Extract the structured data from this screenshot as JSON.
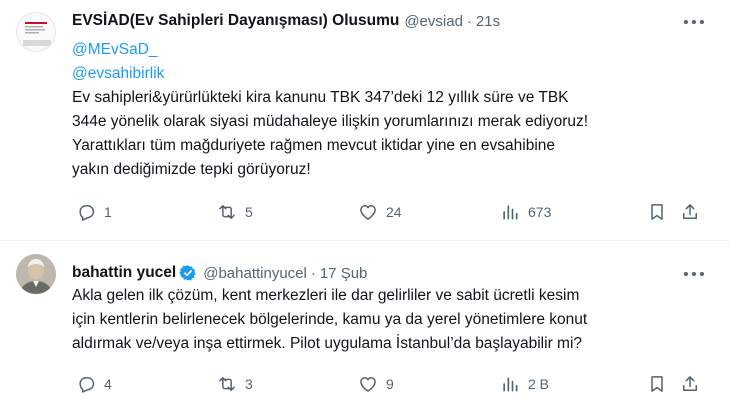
{
  "tweets": [
    {
      "display_name": "EVSİAD(Ev Sahipleri Dayanışması) Olusumu",
      "handle": "@evsiad",
      "separator": "·",
      "time": "21s",
      "mentions": [
        "@MEvSaD_",
        "@evsahibirlik"
      ],
      "lines": [
        "Ev sahipleri&yürürlükteki kira kanunu TBK 347’deki 12 yıllık süre ve TBK",
        "344e yönelik olarak siyasi müdahaleye ilişkin yorumlarınızı merak ediyoruz!",
        "Yarattıkları tüm mağduriyete rağmen mevcut iktidar yine en evsahibine",
        "yakın dediğimizde tepki görüyoruz!"
      ],
      "replies": "1",
      "retweets": "5",
      "likes": "24",
      "views": "673",
      "verified": false
    },
    {
      "display_name": "bahattin yucel",
      "handle": "@bahattinyucel",
      "separator": "·",
      "time": "17 Şub",
      "mentions": [],
      "lines": [
        "Akla gelen ilk çözüm, kent merkezleri ile dar gelirliler ve sabit ücretli kesim",
        "için kentlerin belirlenecek bölgelerinde, kamu ya da yerel yönetimlere konut",
        "aldırmak ve/veya inşa ettirmek. Pilot uygulama İstanbul’da başlayabilir mi?"
      ],
      "replies": "4",
      "retweets": "3",
      "likes": "9",
      "views": "2 B",
      "verified": true
    }
  ],
  "colors": {
    "text": "#0f1419",
    "secondary": "#536471",
    "link": "#1d9bf0",
    "verified": "#1d9bf0",
    "separator": "#eff3f4"
  },
  "icons": [
    "reply-icon",
    "retweet-icon",
    "like-icon",
    "views-icon",
    "bookmark-icon",
    "share-icon",
    "more-icon",
    "verified-badge-icon"
  ]
}
